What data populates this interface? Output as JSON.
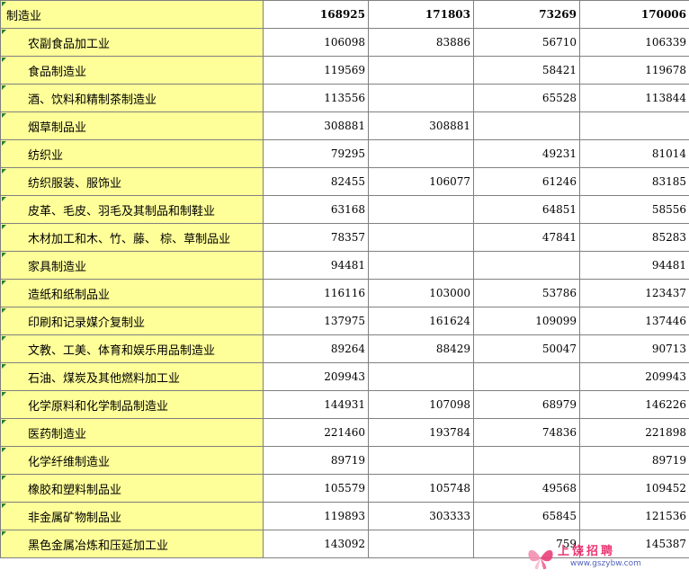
{
  "header": {
    "label": "制造业",
    "values": [
      "168925",
      "171803",
      "73269",
      "170006"
    ]
  },
  "rows": [
    {
      "name": "农副食品加工业",
      "v1": "106098",
      "v2": "83886",
      "v3": "56710",
      "v4": "106339"
    },
    {
      "name": "食品制造业",
      "v1": "119569",
      "v2": "",
      "v3": "58421",
      "v4": "119678"
    },
    {
      "name": "酒、饮料和精制茶制造业",
      "v1": "113556",
      "v2": "",
      "v3": "65528",
      "v4": "113844"
    },
    {
      "name": "烟草制品业",
      "v1": "308881",
      "v2": "308881",
      "v3": "",
      "v4": ""
    },
    {
      "name": "纺织业",
      "v1": "79295",
      "v2": "",
      "v3": "49231",
      "v4": "81014"
    },
    {
      "name": "纺织服装、服饰业",
      "v1": "82455",
      "v2": "106077",
      "v3": "61246",
      "v4": "83185"
    },
    {
      "name": "皮革、毛皮、羽毛及其制品和制鞋业",
      "v1": "63168",
      "v2": "",
      "v3": "64851",
      "v4": "58556"
    },
    {
      "name": "木材加工和木、竹、藤、 棕、草制品业",
      "v1": "78357",
      "v2": "",
      "v3": "47841",
      "v4": "85283"
    },
    {
      "name": "家具制造业",
      "v1": "94481",
      "v2": "",
      "v3": "",
      "v4": "94481"
    },
    {
      "name": "造纸和纸制品业",
      "v1": "116116",
      "v2": "103000",
      "v3": "53786",
      "v4": "123437"
    },
    {
      "name": "印刷和记录媒介复制业",
      "v1": "137975",
      "v2": "161624",
      "v3": "109099",
      "v4": "137446"
    },
    {
      "name": "文教、工美、体育和娱乐用品制造业",
      "v1": "89264",
      "v2": "88429",
      "v3": "50047",
      "v4": "90713"
    },
    {
      "name": "石油、煤炭及其他燃料加工业",
      "v1": "209943",
      "v2": "",
      "v3": "",
      "v4": "209943"
    },
    {
      "name": "化学原料和化学制品制造业",
      "v1": "144931",
      "v2": "107098",
      "v3": "68979",
      "v4": "146226"
    },
    {
      "name": "医药制造业",
      "v1": "221460",
      "v2": "193784",
      "v3": "74836",
      "v4": "221898"
    },
    {
      "name": "化学纤维制造业",
      "v1": "89719",
      "v2": "",
      "v3": "",
      "v4": "89719"
    },
    {
      "name": "橡胶和塑料制品业",
      "v1": "105579",
      "v2": "105748",
      "v3": "49568",
      "v4": "109452"
    },
    {
      "name": "非金属矿物制品业",
      "v1": "119893",
      "v2": "303333",
      "v3": "65845",
      "v4": "121536"
    },
    {
      "name": "黑色金属冶炼和压延加工业",
      "v1": "143092",
      "v2": "",
      "v3": "759",
      "v4": "145387"
    }
  ],
  "watermark": {
    "title": "上饶招聘",
    "url": "www.gszybw.com"
  },
  "colors": {
    "label_fill": "#ffff99",
    "grid": "#808080",
    "indicator": "#2e7d32"
  }
}
